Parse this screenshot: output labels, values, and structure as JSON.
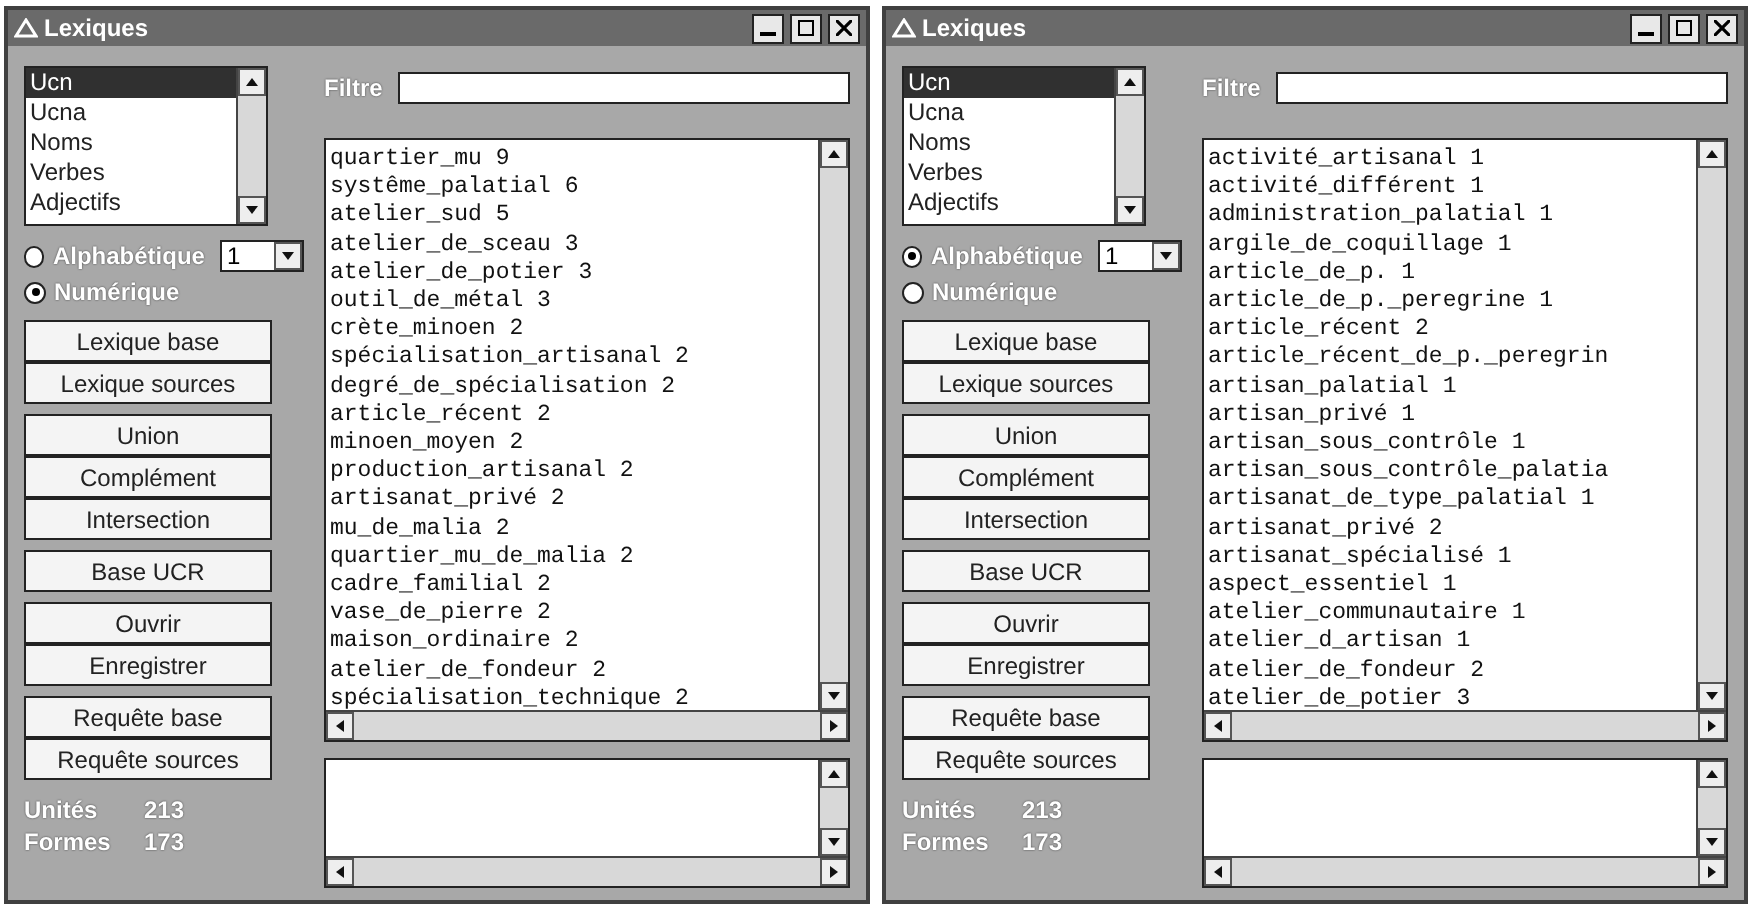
{
  "windows": [
    {
      "title": "Lexiques",
      "categories": [
        {
          "label": "Ucn",
          "selected": true
        },
        {
          "label": "Ucna",
          "selected": false
        },
        {
          "label": "Noms",
          "selected": false
        },
        {
          "label": "Verbes",
          "selected": false
        },
        {
          "label": "Adjectifs",
          "selected": false
        }
      ],
      "sort_options": [
        {
          "label": "Alphabétique",
          "selected": false
        },
        {
          "label": "Numérique",
          "selected": true
        }
      ],
      "dropdown": {
        "value": "1"
      },
      "button_groups": [
        [
          "Lexique base",
          "Lexique sources"
        ],
        [
          "Union",
          "Complément",
          "Intersection"
        ],
        [
          "Base UCR"
        ],
        [
          "Ouvrir",
          "Enregistrer"
        ],
        [
          "Requête base",
          "Requête sources"
        ]
      ],
      "stats": [
        {
          "label": "Unités",
          "value": "213"
        },
        {
          "label": "Formes",
          "value": "173"
        }
      ],
      "filter": {
        "label": "Filtre"
      },
      "entries": [
        "quartier_mu 9",
        "systême_palatial 6",
        "atelier_sud 5",
        "atelier_de_sceau 3",
        "atelier_de_potier 3",
        "outil_de_métal 3",
        "crète_minoen 2",
        "spécialisation_artisanal 2",
        "degré_de_spécialisation 2",
        "article_récent 2",
        "minoen_moyen 2",
        "production_artisanal 2",
        "artisanat_privé 2",
        "mu_de_malia 2",
        "quartier_mu_de_malia 2",
        "cadre_familial 2",
        "vase_de_pierre 2",
        "maison_ordinaire 2",
        "atelier_de_fondeur 2",
        "spécialisation_technique 2"
      ]
    },
    {
      "title": "Lexiques",
      "categories": [
        {
          "label": "Ucn",
          "selected": true
        },
        {
          "label": "Ucna",
          "selected": false
        },
        {
          "label": "Noms",
          "selected": false
        },
        {
          "label": "Verbes",
          "selected": false
        },
        {
          "label": "Adjectifs",
          "selected": false
        }
      ],
      "sort_options": [
        {
          "label": "Alphabétique",
          "selected": true
        },
        {
          "label": "Numérique",
          "selected": false
        }
      ],
      "dropdown": {
        "value": "1"
      },
      "button_groups": [
        [
          "Lexique base",
          "Lexique sources"
        ],
        [
          "Union",
          "Complément",
          "Intersection"
        ],
        [
          "Base UCR"
        ],
        [
          "Ouvrir",
          "Enregistrer"
        ],
        [
          "Requête base",
          "Requête sources"
        ]
      ],
      "stats": [
        {
          "label": "Unités",
          "value": "213"
        },
        {
          "label": "Formes",
          "value": "173"
        }
      ],
      "filter": {
        "label": "Filtre"
      },
      "entries": [
        "activité_artisanal 1",
        "activité_différent 1",
        "administration_palatial 1",
        "argile_de_coquillage 1",
        "article_de_p. 1",
        "article_de_p._peregrine 1",
        "article_récent 2",
        "article_récent_de_p._peregrin",
        "artisan_palatial 1",
        "artisan_privé 1",
        "artisan_sous_contrôle 1",
        "artisan_sous_contrôle_palatia",
        "artisanat_de_type_palatial 1",
        "artisanat_privé 2",
        "artisanat_spécialisé 1",
        "aspect_essentiel 1",
        "atelier_communautaire 1",
        "atelier_d_artisan 1",
        "atelier_de_fondeur 2",
        "atelier_de_potier 3"
      ]
    }
  ]
}
